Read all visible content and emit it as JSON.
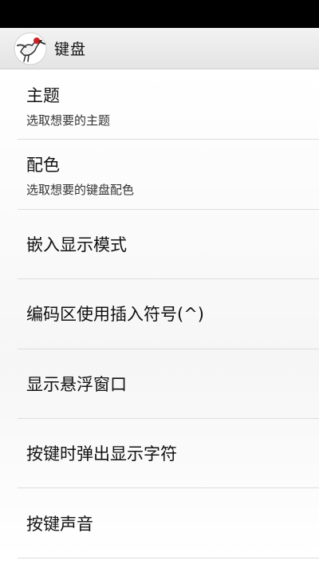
{
  "action_bar": {
    "title": "键盘",
    "icon": "crane-logo-icon"
  },
  "settings": [
    {
      "title": "主题",
      "summary": "选取想要的主题"
    },
    {
      "title": "配色",
      "summary": "选取想要的键盘配色"
    },
    {
      "title": "嵌入显示模式"
    },
    {
      "title": "编码区使用插入符号(^)"
    },
    {
      "title": "显示悬浮窗口"
    },
    {
      "title": "按键时弹出显示字符"
    },
    {
      "title": "按键声音"
    }
  ]
}
